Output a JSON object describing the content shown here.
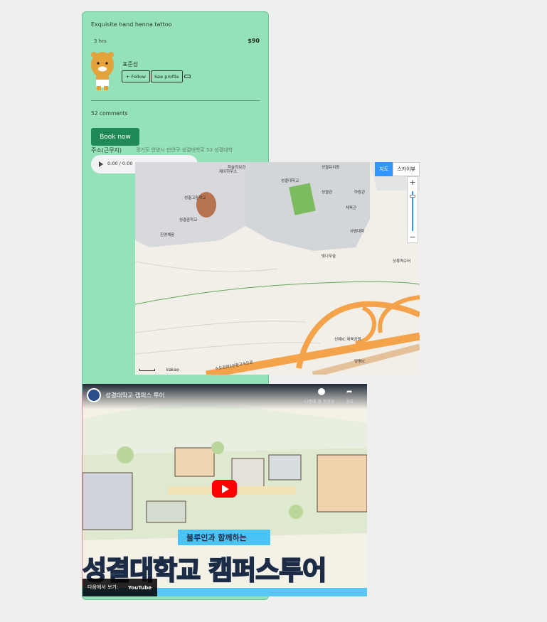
{
  "card": {
    "title": "Exquisite hand henna tattoo",
    "duration": "3 hrs",
    "price": "$90",
    "author": "표준성",
    "follow_label": "+ Follow",
    "profile_label": "See profile",
    "comments": "52 comments",
    "book_label": "Book now",
    "address_label": "주소(근무지)",
    "address_value": "경기도 안양시 만안구 성결대학로 53 성결대학",
    "audio_time": "0:00 / 0:00"
  },
  "map": {
    "tabs": [
      "지도",
      "스카이뷰"
    ],
    "active_tab": "지도",
    "zoom_in": "+",
    "zoom_out": "−",
    "brand": "kakao",
    "labels": [
      "학술정보관",
      "성결대학교",
      "성결고등학교",
      "성결중학교",
      "진영채움",
      "성결유치원",
      "제이하우스",
      "하람관",
      "체육관",
      "사범대학",
      "빛나무숲",
      "상록역수터",
      "신예IC 체육공원",
      "수도권제1순환고속도로",
      "양평IC",
      "성결관"
    ]
  },
  "video": {
    "title": "성결대학교 캠퍼스 투어",
    "action1": "나중에 볼 동영상",
    "action2": "공유",
    "ribbon": "블루인과 함께하는",
    "big_title": "성결대학교 캠퍼스투어",
    "watch_on": "다음에서 보기:",
    "brand": "YouTube"
  }
}
